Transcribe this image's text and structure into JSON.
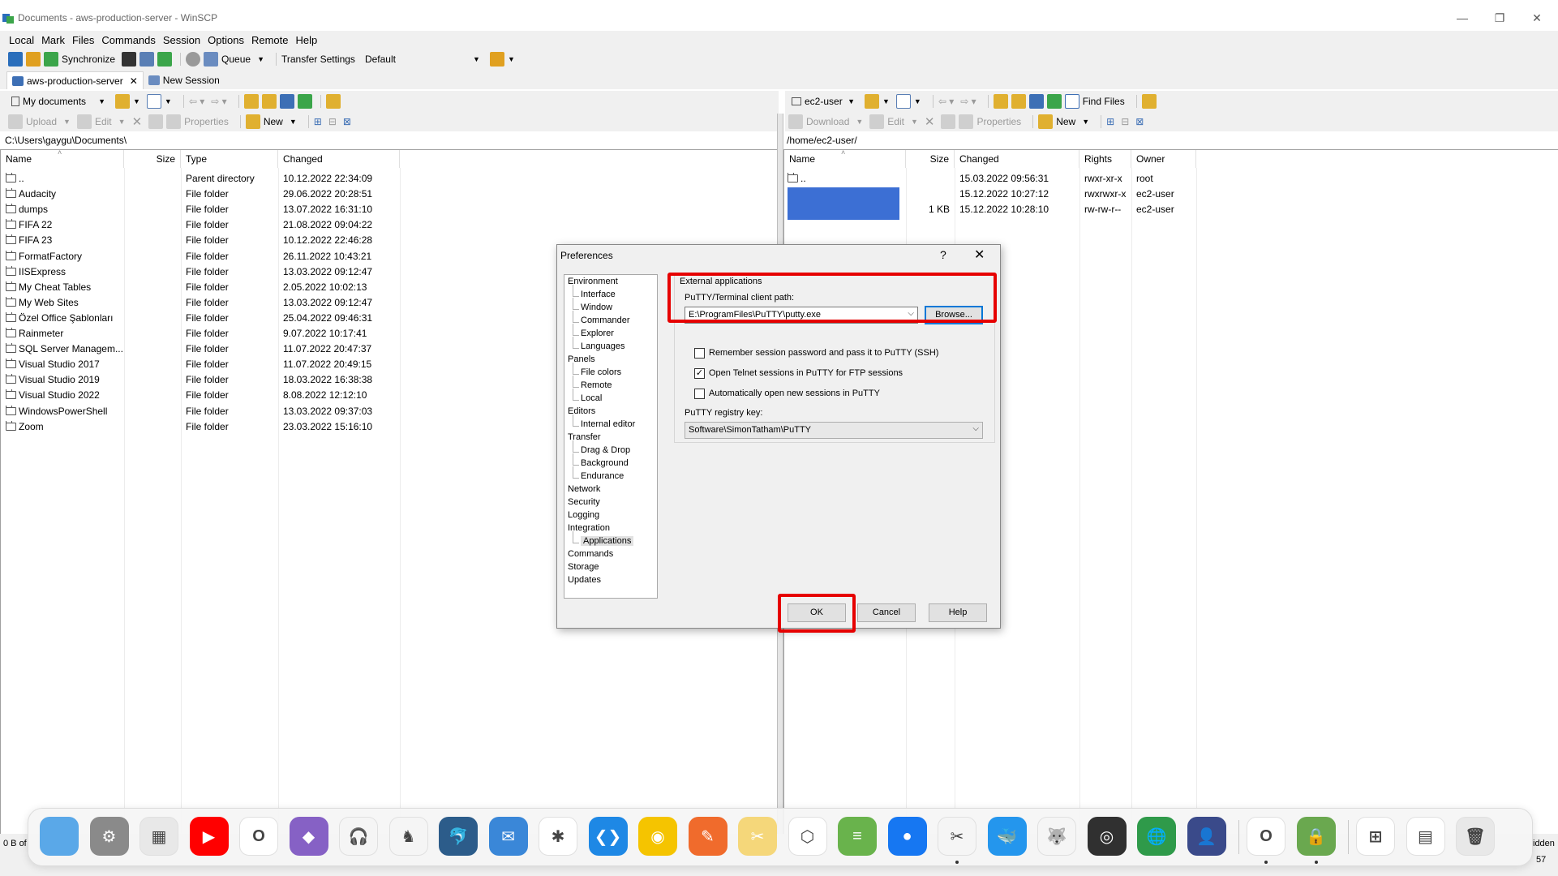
{
  "window": {
    "title": "Documents - aws-production-server - WinSCP",
    "minimize_glyph": "—",
    "restore_glyph": "❐",
    "close_glyph": "✕"
  },
  "menu": [
    "Local",
    "Mark",
    "Files",
    "Commands",
    "Session",
    "Options",
    "Remote",
    "Help"
  ],
  "toolbar": {
    "synchronize": "Synchronize",
    "queue": "Queue",
    "transfer_settings_label": "Transfer Settings",
    "transfer_settings_value": "Default"
  },
  "tabs": {
    "session": "aws-production-server",
    "new_session": "New Session"
  },
  "left": {
    "location": "My documents",
    "upload": "Upload",
    "edit": "Edit",
    "properties": "Properties",
    "new": "New",
    "path": "C:\\Users\\gaygu\\Documents\\",
    "columns": {
      "name": "Name",
      "size": "Size",
      "type": "Type",
      "changed": "Changed"
    },
    "rows": [
      {
        "name": "..",
        "type": "Parent directory",
        "changed": "10.12.2022  22:34:09"
      },
      {
        "name": "Audacity",
        "type": "File folder",
        "changed": "29.06.2022  20:28:51"
      },
      {
        "name": "dumps",
        "type": "File folder",
        "changed": "13.07.2022  16:31:10"
      },
      {
        "name": "FIFA 22",
        "type": "File folder",
        "changed": "21.08.2022  09:04:22"
      },
      {
        "name": "FIFA 23",
        "type": "File folder",
        "changed": "10.12.2022  22:46:28"
      },
      {
        "name": "FormatFactory",
        "type": "File folder",
        "changed": "26.11.2022  10:43:21"
      },
      {
        "name": "IISExpress",
        "type": "File folder",
        "changed": "13.03.2022  09:12:47"
      },
      {
        "name": "My Cheat Tables",
        "type": "File folder",
        "changed": "2.05.2022  10:02:13"
      },
      {
        "name": "My Web Sites",
        "type": "File folder",
        "changed": "13.03.2022  09:12:47"
      },
      {
        "name": "Özel Office Şablonları",
        "type": "File folder",
        "changed": "25.04.2022  09:46:31"
      },
      {
        "name": "Rainmeter",
        "type": "File folder",
        "changed": "9.07.2022  10:17:41"
      },
      {
        "name": "SQL Server Managem...",
        "type": "File folder",
        "changed": "11.07.2022  20:47:37"
      },
      {
        "name": "Visual Studio 2017",
        "type": "File folder",
        "changed": "11.07.2022  20:49:15"
      },
      {
        "name": "Visual Studio 2019",
        "type": "File folder",
        "changed": "18.03.2022  16:38:38"
      },
      {
        "name": "Visual Studio 2022",
        "type": "File folder",
        "changed": "8.08.2022  12:12:10"
      },
      {
        "name": "WindowsPowerShell",
        "type": "File folder",
        "changed": "13.03.2022  09:37:03"
      },
      {
        "name": "Zoom",
        "type": "File folder",
        "changed": "23.03.2022  15:16:10"
      }
    ]
  },
  "right": {
    "location": "ec2-user",
    "find_files": "Find Files",
    "download": "Download",
    "edit": "Edit",
    "properties": "Properties",
    "new": "New",
    "path": "/home/ec2-user/",
    "columns": {
      "name": "Name",
      "size": "Size",
      "changed": "Changed",
      "rights": "Rights",
      "owner": "Owner"
    },
    "rows": [
      {
        "name": "..",
        "size": "",
        "changed": "15.03.2022 09:56:31",
        "rights": "rwxr-xr-x",
        "owner": "root"
      },
      {
        "name": "",
        "size": "",
        "changed": "15.12.2022 10:27:12",
        "rights": "rwxrwxr-x",
        "owner": "ec2-user"
      },
      {
        "name": "",
        "size": "1 KB",
        "changed": "15.12.2022 10:28:10",
        "rights": "rw-rw-r--",
        "owner": "ec2-user"
      }
    ],
    "highlight_color": "#3c6fd4"
  },
  "dialog": {
    "title": "Preferences",
    "help_glyph": "?",
    "close_glyph": "✕",
    "tree": [
      {
        "label": "Environment",
        "level": 0
      },
      {
        "label": "Interface",
        "level": 1
      },
      {
        "label": "Window",
        "level": 1
      },
      {
        "label": "Commander",
        "level": 1
      },
      {
        "label": "Explorer",
        "level": 1
      },
      {
        "label": "Languages",
        "level": 1
      },
      {
        "label": "Panels",
        "level": 0
      },
      {
        "label": "File colors",
        "level": 1
      },
      {
        "label": "Remote",
        "level": 1
      },
      {
        "label": "Local",
        "level": 1
      },
      {
        "label": "Editors",
        "level": 0
      },
      {
        "label": "Internal editor",
        "level": 1
      },
      {
        "label": "Transfer",
        "level": 0
      },
      {
        "label": "Drag & Drop",
        "level": 1
      },
      {
        "label": "Background",
        "level": 1
      },
      {
        "label": "Endurance",
        "level": 1
      },
      {
        "label": "Network",
        "level": 0
      },
      {
        "label": "Security",
        "level": 0
      },
      {
        "label": "Logging",
        "level": 0
      },
      {
        "label": "Integration",
        "level": 0
      },
      {
        "label": "Applications",
        "level": 1,
        "selected": true
      },
      {
        "label": "Commands",
        "level": 0
      },
      {
        "label": "Storage",
        "level": 0
      },
      {
        "label": "Updates",
        "level": 0
      }
    ],
    "group_title": "External applications",
    "putty_path_label": "PuTTY/Terminal client path:",
    "putty_path_value": "E:\\ProgramFiles\\PuTTY\\putty.exe",
    "browse": "Browse...",
    "chk_remember": {
      "label": "Remember session password and pass it to PuTTY (SSH)",
      "checked": false
    },
    "chk_telnet": {
      "label": "Open Telnet sessions in PuTTY for FTP sessions",
      "checked": true
    },
    "chk_auto": {
      "label": "Automatically open new sessions in PuTTY",
      "checked": false
    },
    "registry_label": "PuTTY registry key:",
    "registry_value": "Software\\SimonTatham\\PuTTY",
    "ok": "OK",
    "cancel": "Cancel",
    "help": "Help",
    "highlight_color": "#e60000"
  },
  "status": {
    "left_text": "0 B of",
    "right_text_top": "idden",
    "right_text_bottom": "57"
  },
  "dock": {
    "apps": [
      {
        "icon": "finder-icon",
        "color": "#5aa8e8",
        "glyph": ""
      },
      {
        "icon": "system-settings-icon",
        "color": "#8a8a8a",
        "glyph": "⚙"
      },
      {
        "icon": "launchpad-icon",
        "color": "#e8e8e8",
        "glyph": "▦"
      },
      {
        "icon": "youtube-icon",
        "color": "#ff0000",
        "glyph": "▶"
      },
      {
        "icon": "opera-icon",
        "color": "#ffffff",
        "glyph": "O"
      },
      {
        "icon": "visual-studio-icon",
        "color": "#8661c5",
        "glyph": "◆"
      },
      {
        "icon": "audacity-icon",
        "color": "#f5f5f5",
        "glyph": "🎧"
      },
      {
        "icon": "vlc-icon",
        "color": "#f5f5f5",
        "glyph": "♞"
      },
      {
        "icon": "mysql-workbench-icon",
        "color": "#2c5c8a",
        "glyph": "🐬"
      },
      {
        "icon": "thunderbird-icon",
        "color": "#3a87d8",
        "glyph": "✉"
      },
      {
        "icon": "slack-icon",
        "color": "#ffffff",
        "glyph": "✱"
      },
      {
        "icon": "vscode-icon",
        "color": "#1e88e5",
        "glyph": "❮❯"
      },
      {
        "icon": "tor-icon",
        "color": "#f5c400",
        "glyph": "◉"
      },
      {
        "icon": "swift-playgrounds-icon",
        "color": "#f06b2c",
        "glyph": "✎"
      },
      {
        "icon": "scrivener-icon",
        "color": "#f5d77a",
        "glyph": "✂"
      },
      {
        "icon": "unity-icon",
        "color": "#ffffff",
        "glyph": "⬡"
      },
      {
        "icon": "bluestacks-icon",
        "color": "#69b34c",
        "glyph": "≡"
      },
      {
        "icon": "maps-pin-icon",
        "color": "#1677f2",
        "glyph": "●"
      },
      {
        "icon": "snipping-tool-icon",
        "color": "#f5f5f5",
        "glyph": "✂"
      },
      {
        "icon": "docker-icon",
        "color": "#2496ed",
        "glyph": "🐳"
      },
      {
        "icon": "gimp-icon",
        "color": "#f5f5f5",
        "glyph": "🐺"
      },
      {
        "icon": "obs-icon",
        "color": "#303030",
        "glyph": "◎"
      },
      {
        "icon": "earth-icon",
        "color": "#2f9a4a",
        "glyph": "🌐"
      },
      {
        "icon": "profile-photo-icon",
        "color": "#3a4a8a",
        "glyph": "👤"
      },
      {
        "icon": "opera-gx-icon",
        "color": "#ffffff",
        "glyph": "O"
      },
      {
        "icon": "secure-lock-icon",
        "color": "#6aa84f",
        "glyph": "🔒"
      },
      {
        "icon": "windows-icon",
        "color": "#ffffff",
        "glyph": "⊞"
      },
      {
        "icon": "document-preview-icon",
        "color": "#ffffff",
        "glyph": "▤"
      },
      {
        "icon": "trash-icon",
        "color": "#e8e8e8",
        "glyph": "🗑"
      }
    ]
  }
}
